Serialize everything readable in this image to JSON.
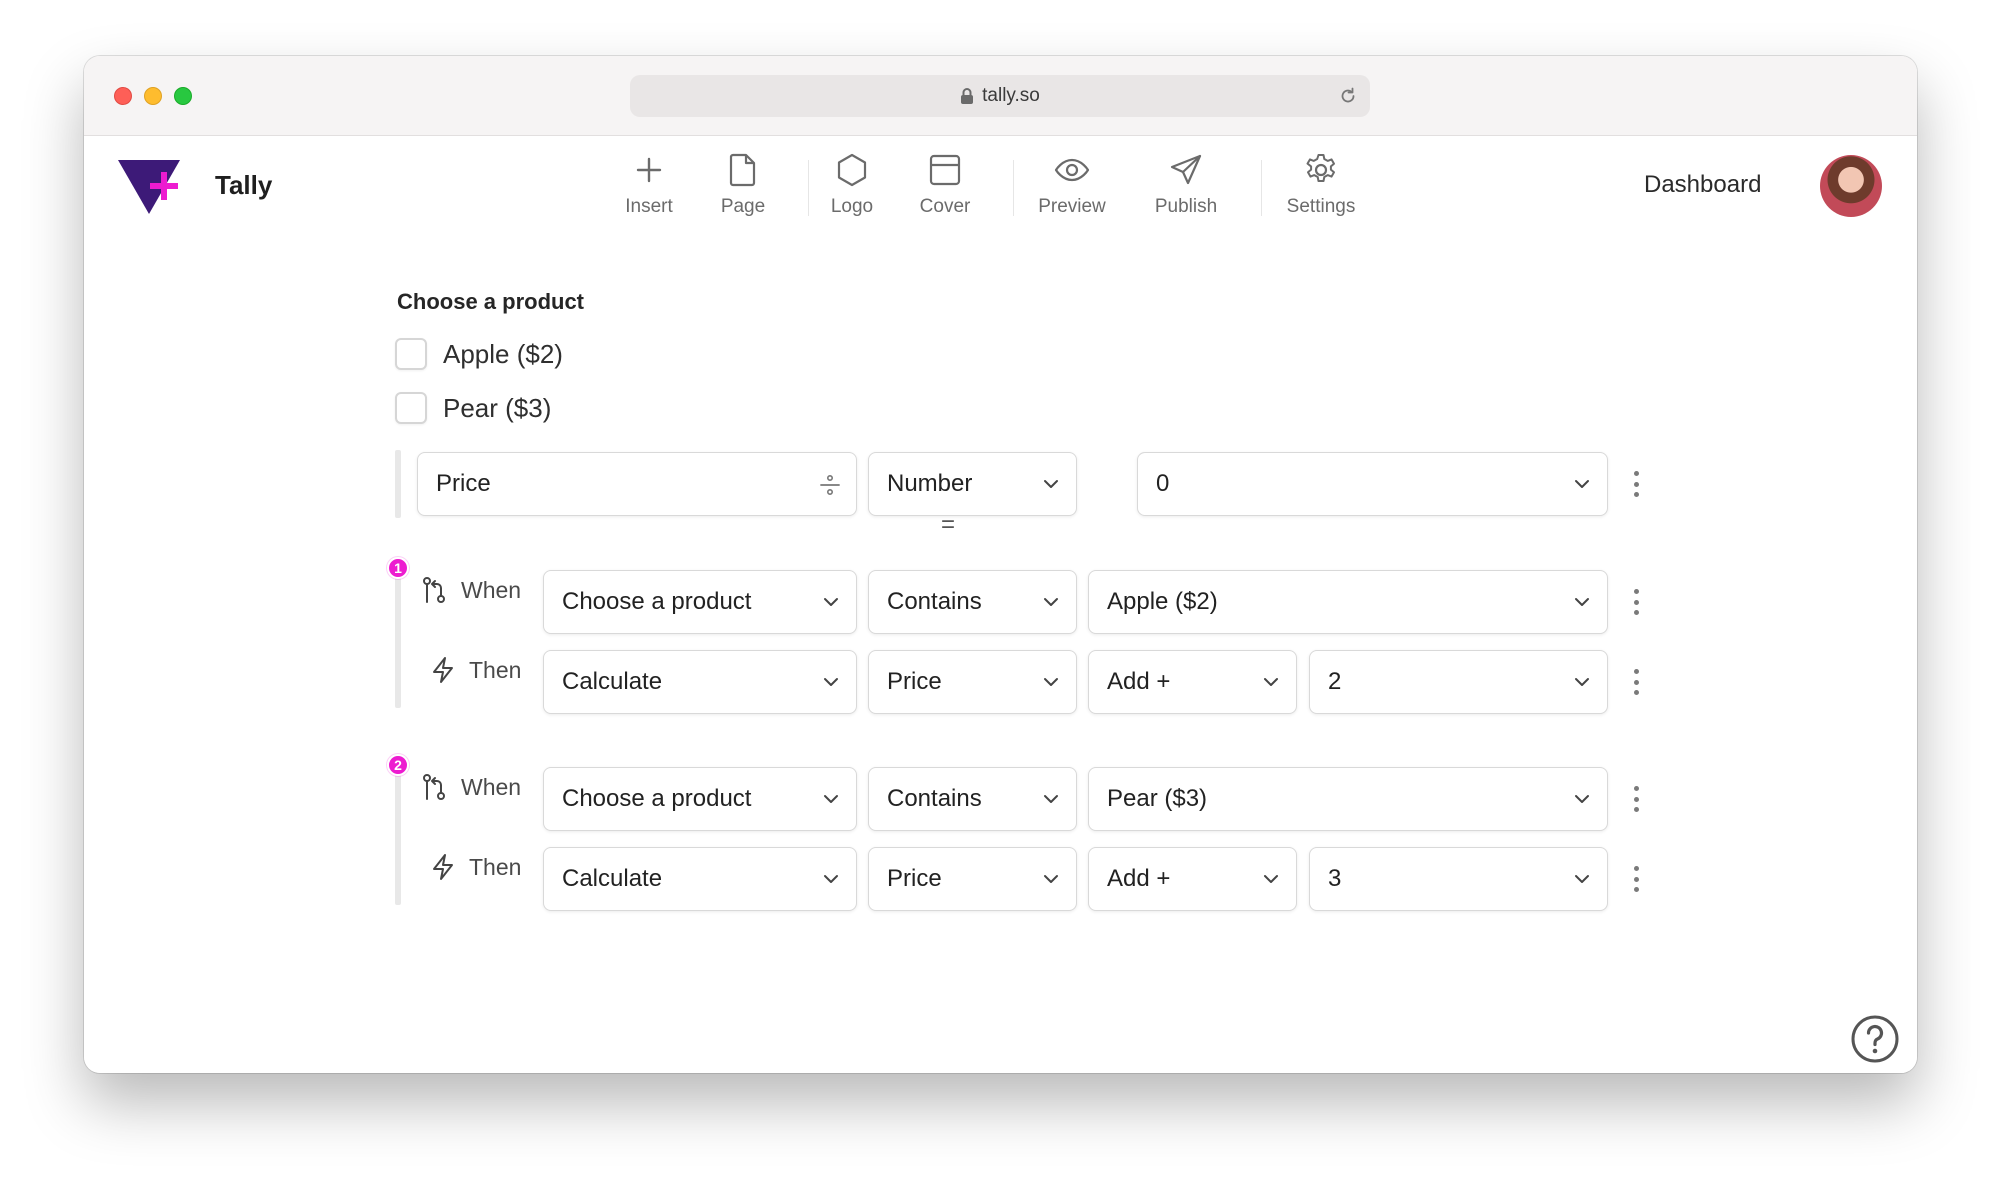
{
  "browser": {
    "url": "tally.so"
  },
  "app": {
    "brand": "Tally",
    "dashboard_label": "Dashboard"
  },
  "toolbar": [
    {
      "label": "Insert",
      "icon": "plus-icon"
    },
    {
      "label": "Page",
      "icon": "page-icon"
    },
    {
      "label": "Logo",
      "icon": "hexagon-icon"
    },
    {
      "label": "Cover",
      "icon": "cover-icon"
    },
    {
      "label": "Preview",
      "icon": "eye-icon"
    },
    {
      "label": "Publish",
      "icon": "send-icon"
    },
    {
      "label": "Settings",
      "icon": "gear-icon"
    }
  ],
  "question": {
    "title": "Choose a product",
    "options": [
      "Apple ($2)",
      "Pear ($3)"
    ]
  },
  "calculated_field": {
    "name": "Price",
    "type": "Number",
    "operator": "=",
    "initial_value": "0"
  },
  "rules": [
    {
      "number": "1",
      "when_label": "When",
      "when": {
        "field": "Choose a product",
        "comparison": "Contains",
        "value": "Apple ($2)"
      },
      "then_label": "Then",
      "then": {
        "action": "Calculate",
        "target": "Price",
        "operation": "Add +",
        "value": "2"
      }
    },
    {
      "number": "2",
      "when_label": "When",
      "when": {
        "field": "Choose a product",
        "comparison": "Contains",
        "value": "Pear ($3)"
      },
      "then_label": "Then",
      "then": {
        "action": "Calculate",
        "target": "Price",
        "operation": "Add +",
        "value": "3"
      }
    }
  ],
  "colors": {
    "accent": "#ed1bd0",
    "logo_purple": "#3d1a78"
  }
}
